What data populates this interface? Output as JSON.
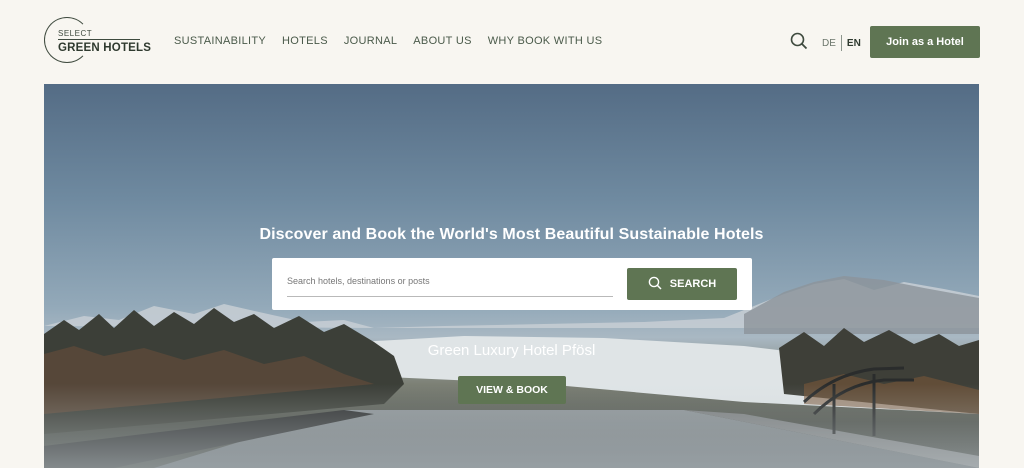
{
  "header": {
    "logo": {
      "top_text": "SELECT",
      "main_text": "GREEN HOTELS"
    },
    "nav": [
      {
        "label": "SUSTAINABILITY"
      },
      {
        "label": "HOTELS"
      },
      {
        "label": "JOURNAL"
      },
      {
        "label": "ABOUT US"
      },
      {
        "label": "WHY BOOK WITH US"
      }
    ],
    "languages": [
      "DE",
      "EN"
    ],
    "active_language": "EN",
    "join_button": "Join as a Hotel"
  },
  "hero": {
    "headline": "Discover and Book the World's Most Beautiful Sustainable Hotels",
    "search": {
      "placeholder": "Search hotels, destinations or posts",
      "value": "",
      "button_label": "SEARCH"
    },
    "hotel_name": "Green Luxury Hotel Pfösl",
    "cta_label": "VIEW & BOOK"
  },
  "colors": {
    "accent": "#5f7553",
    "background": "#f8f6f1",
    "text": "#4a5a4a"
  },
  "icons": {
    "search": "search-icon"
  }
}
